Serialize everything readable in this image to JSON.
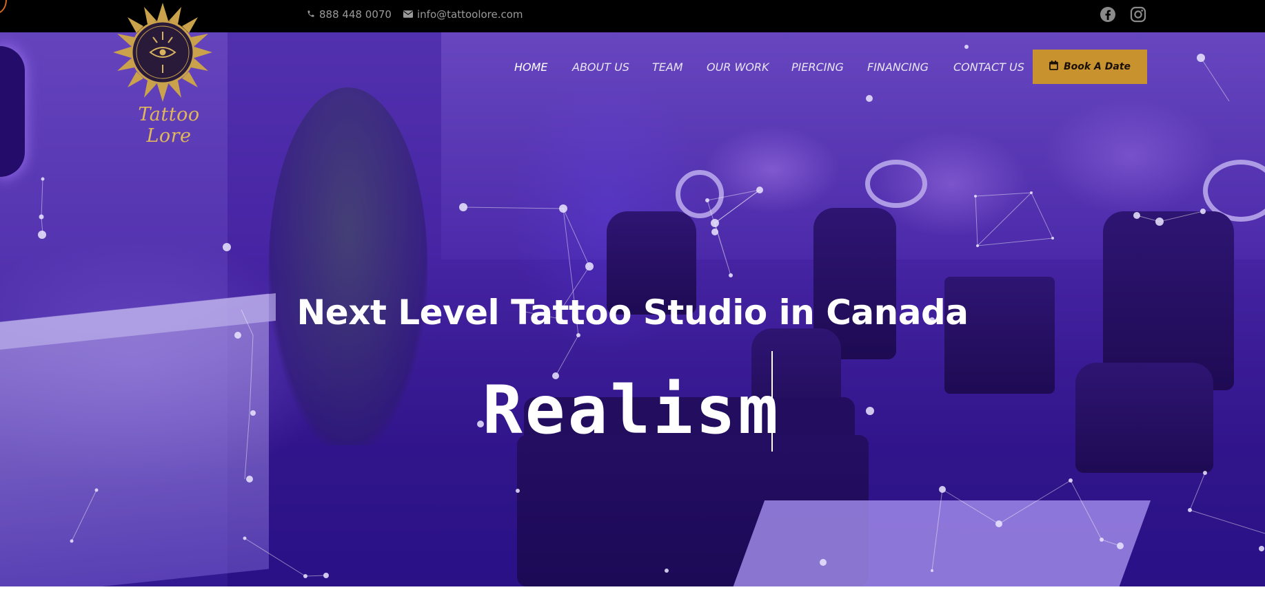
{
  "topbar": {
    "phone": "888 448 0070",
    "email": "info@tattoolore.com",
    "social": [
      "facebook-icon",
      "instagram-icon"
    ]
  },
  "logo": {
    "text": "Tattoo Lore"
  },
  "nav": {
    "items": [
      {
        "label": "HOME",
        "active": true
      },
      {
        "label": "ABOUT US",
        "active": false
      },
      {
        "label": "TEAM",
        "active": false
      },
      {
        "label": "OUR WORK",
        "active": false
      },
      {
        "label": "PIERCING",
        "active": false
      },
      {
        "label": "FINANCING",
        "active": false
      },
      {
        "label": "CONTACT US",
        "active": false
      }
    ],
    "cta": "Book A Date"
  },
  "hero": {
    "headline": "Next Level Tattoo Studio in Canada",
    "typed_word": "Realism"
  },
  "colors": {
    "topbar_bg": "#000000",
    "accent_gold": "#c8922f",
    "overlay_purple": "#3c14aa"
  }
}
